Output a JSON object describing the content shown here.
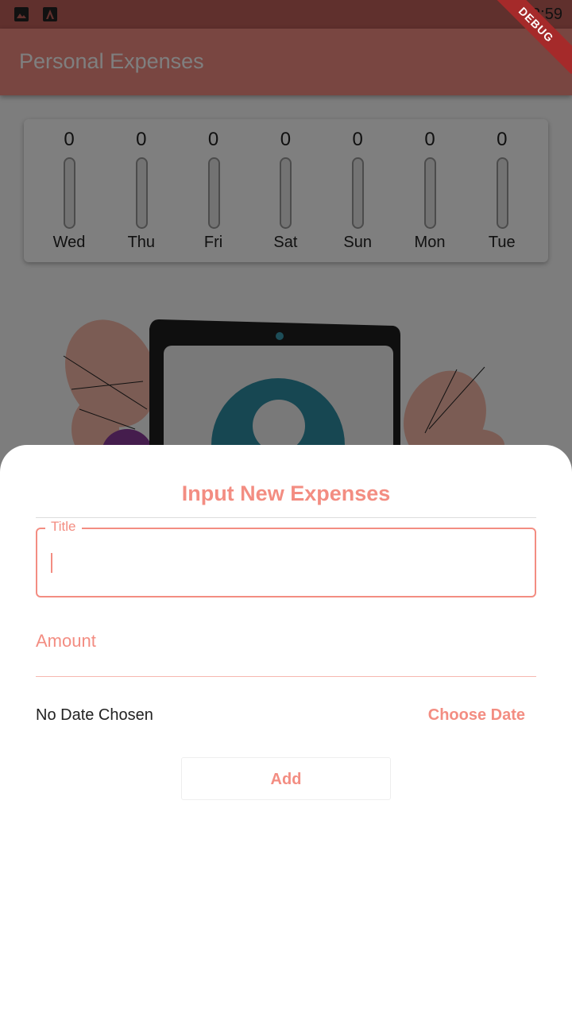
{
  "status_bar": {
    "time": "12:59",
    "icons": [
      "image-icon",
      "a-notification-icon"
    ]
  },
  "app_bar": {
    "title": "Personal Expenses"
  },
  "chart": {
    "bars": [
      {
        "amount": "0",
        "day": "Wed",
        "fill_fraction": 0
      },
      {
        "amount": "0",
        "day": "Thu",
        "fill_fraction": 0
      },
      {
        "amount": "0",
        "day": "Fri",
        "fill_fraction": 0
      },
      {
        "amount": "0",
        "day": "Sat",
        "fill_fraction": 0
      },
      {
        "amount": "0",
        "day": "Sun",
        "fill_fraction": 0
      },
      {
        "amount": "0",
        "day": "Mon",
        "fill_fraction": 0
      },
      {
        "amount": "0",
        "day": "Tue",
        "fill_fraction": 0
      }
    ]
  },
  "debug_banner": "DEBUG",
  "sheet": {
    "title": "Input New Expenses",
    "title_field": {
      "label": "Title",
      "value": ""
    },
    "amount_field": {
      "label": "Amount",
      "value": ""
    },
    "date_text": "No Date Chosen",
    "choose_date_label": "Choose Date",
    "add_label": "Add"
  },
  "colors": {
    "primary": "#f38d82",
    "debug": "#a52a2a",
    "scrim": "rgba(0,0,0,0.5)"
  }
}
